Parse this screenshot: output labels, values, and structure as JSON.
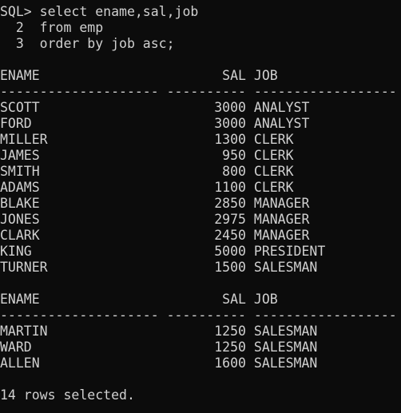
{
  "terminal": {
    "lines": [
      "SQL> select ename,sal,job",
      "  2  from emp",
      "  3  order by job asc;",
      "",
      "ENAME                       SAL JOB",
      "-------------------- ---------- ------------------",
      "SCOTT                      3000 ANALYST",
      "FORD                       3000 ANALYST",
      "MILLER                     1300 CLERK",
      "JAMES                       950 CLERK",
      "SMITH                       800 CLERK",
      "ADAMS                      1100 CLERK",
      "BLAKE                      2850 MANAGER",
      "JONES                      2975 MANAGER",
      "CLARK                      2450 MANAGER",
      "KING                       5000 PRESIDENT",
      "TURNER                     1500 SALESMAN",
      "",
      "ENAME                       SAL JOB",
      "-------------------- ---------- ------------------",
      "MARTIN                     1250 SALESMAN",
      "WARD                       1250 SALESMAN",
      "ALLEN                      1600 SALESMAN",
      "",
      "14 rows selected."
    ]
  },
  "colors": {
    "background": "#0c0c0c",
    "text": "#d0d0d0"
  }
}
